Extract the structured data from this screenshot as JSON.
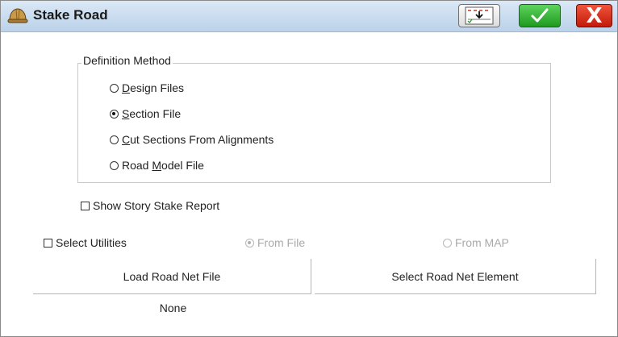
{
  "window": {
    "title": "Stake Road",
    "icon": "hard-hat-icon"
  },
  "toolbar": {
    "export_icon": "export-report-icon",
    "ok_icon": "checkmark-icon",
    "cancel_label": "X"
  },
  "definition_method": {
    "legend": "Definition Method",
    "options": [
      {
        "label_pre": "",
        "label_key": "D",
        "label_post": "esign Files",
        "selected": false
      },
      {
        "label_pre": "",
        "label_key": "S",
        "label_post": "ection File",
        "selected": true
      },
      {
        "label_pre": "",
        "label_key": "C",
        "label_post": "ut Sections From Alignments",
        "selected": false
      },
      {
        "label_pre": "Road ",
        "label_key": "M",
        "label_post": "odel File",
        "selected": false
      }
    ]
  },
  "show_story_report": {
    "label": "Show Story Stake Report",
    "checked": false
  },
  "select_utilities": {
    "label": "Select Utilities",
    "checked": false
  },
  "source": {
    "from_file": {
      "label": "From File",
      "selected": true,
      "enabled": false
    },
    "from_map": {
      "label": "From MAP",
      "selected": false,
      "enabled": false
    }
  },
  "buttons": {
    "load": "Load Road Net File",
    "select": "Select Road Net Element"
  },
  "status_text": "None",
  "colors": {
    "ok_green": "#2fae2f",
    "cancel_red": "#d8301a",
    "title_bar": "#c9dcef"
  }
}
